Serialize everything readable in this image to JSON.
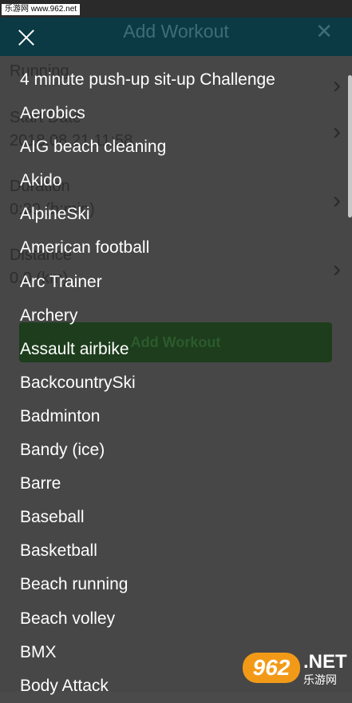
{
  "watermark": "乐游网 www.962.net",
  "header": {
    "title": "Add Workout",
    "close_icon": "close-icon"
  },
  "form": {
    "fields": [
      {
        "label": "Running",
        "value": ""
      },
      {
        "label": "Start Date",
        "value": "2018.08.21 11:58"
      },
      {
        "label": "Duration",
        "value": "0:30 (h:min)"
      },
      {
        "label": "Distance",
        "value": "0.0 (km)"
      }
    ],
    "submit_label": "Add Workout"
  },
  "overlay": {
    "close_icon": "close-icon",
    "items": [
      "4 minute push-up sit-up Challenge",
      "Aerobics",
      "AIG beach cleaning",
      "Akido",
      "AlpineSki",
      "American football",
      "Arc Trainer",
      "Archery",
      "Assault airbike",
      "BackcountrySki",
      "Badminton",
      "Bandy (ice)",
      "Barre",
      "Baseball",
      "Basketball",
      "Beach running",
      "Beach volley",
      "BMX",
      "Body Attack"
    ]
  },
  "logo": {
    "number": "962",
    "net": ".NET",
    "cn": "乐游网"
  },
  "colors": {
    "overlay_bg": "#4a4a4a",
    "appbar": "#0b3a45",
    "text": "#ffffff",
    "logo_orange": "#f29a18"
  }
}
